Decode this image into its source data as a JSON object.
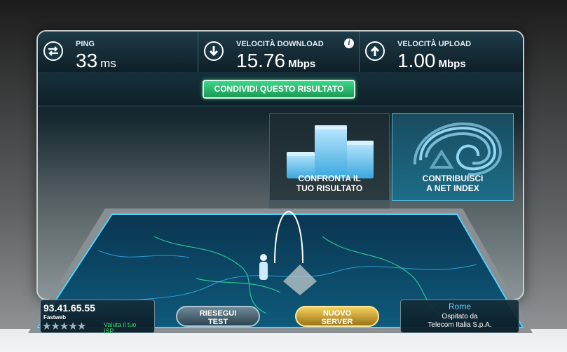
{
  "stats": {
    "ping": {
      "label": "PING",
      "value": "33",
      "unit": "ms",
      "icon": "swap-arrows-icon"
    },
    "download": {
      "label": "VELOCITÀ DOWNLOAD",
      "value": "15.76",
      "unit": "Mbps",
      "icon": "arrow-down-icon",
      "info": "i"
    },
    "upload": {
      "label": "VELOCITÀ UPLOAD",
      "value": "1.00",
      "unit": "Mbps",
      "icon": "arrow-up-icon"
    }
  },
  "share": {
    "label": "CONDIVIDI QUESTO RISULTATO"
  },
  "tiles": {
    "compare": {
      "line1": "CONFRONTA IL",
      "line2": "TUO RISULTATO"
    },
    "contribute": {
      "line1": "CONTRIBUISCI",
      "line2": "A NET INDEX"
    }
  },
  "client": {
    "ip": "93.41.65.55",
    "isp": "Fastweb",
    "stars": "★★★★★",
    "rate_line1": "Valuta il tuo",
    "rate_line2": "ISP"
  },
  "buttons": {
    "retest": {
      "line1": "RIESEGUI",
      "line2": "TEST"
    },
    "new_server": {
      "line1": "NUOVO",
      "line2": "SERVER"
    }
  },
  "server": {
    "city": "Rome",
    "hosted_line1": "Ospitato da",
    "hosted_line2": "Telecom Italia S.p.A."
  },
  "colors": {
    "accent_green": "#2ecf78",
    "accent_gold": "#e8c24a",
    "tile_blue": "#1c6d88",
    "map_glow": "#38c6ff"
  }
}
